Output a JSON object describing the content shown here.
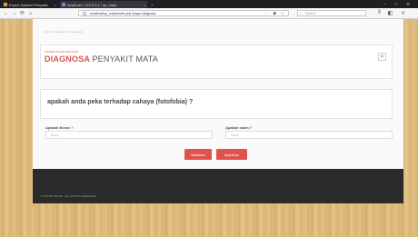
{
  "browser": {
    "tabs": [
      {
        "label": "Expert System Penyakit",
        "active": false
      },
      {
        "label": "localhost / 127.0.0.1 / sp_mata",
        "active": true
      }
    ],
    "new_tab": "+",
    "url": "localhost/sp_mata/index.php?page=diagnosa",
    "search_placeholder": "Search",
    "nav": {
      "back": "←",
      "forward": "→",
      "reload": "⟳",
      "home": "⌂"
    },
    "window": {
      "minimize": "–",
      "maximize": "□",
      "close": "✕"
    }
  },
  "page": {
    "breadcrumb": "Home > Diagnosa > Pertanyaan",
    "header": {
      "tagline": "SISTEM PAKAR PENYAKIT",
      "title_accent": "DIAGNOSA",
      "title_rest": "PENYAKIT MATA",
      "close": "✕"
    },
    "question": {
      "marker": "•",
      "text": "apakah anda peka terhadap cahaya (fotofobia) ?"
    },
    "options": [
      {
        "label": "Apakah Benar ?",
        "placeholder": "Benar"
      },
      {
        "label": "Apakah salah ?",
        "placeholder": "Salah"
      }
    ],
    "buttons": {
      "back": "Batalkan",
      "next": "lanjutkan"
    }
  },
  "footer": {
    "text": "© SISTEM PAKAR - ALL RIGHTS RESERVED"
  },
  "colors": {
    "accent": "#d9534f",
    "footer_bg": "#2b2b2b",
    "button": "#e0524d"
  }
}
